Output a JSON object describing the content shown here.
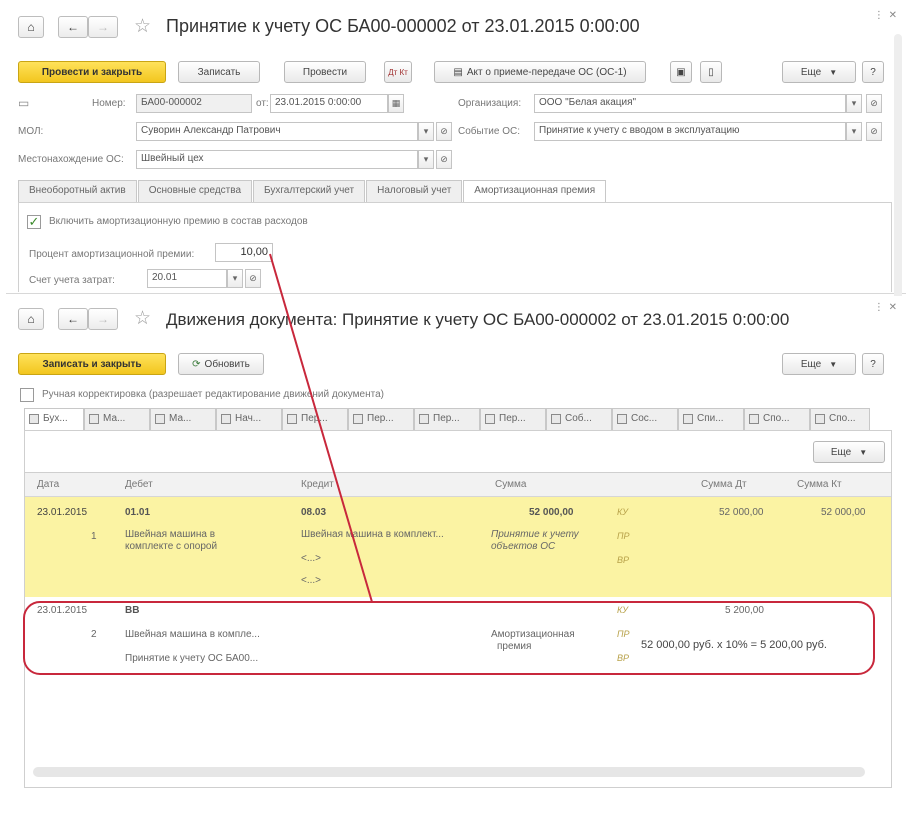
{
  "win1": {
    "title": "Принятие к учету ОС БА00-000002 от 23.01.2015 0:00:00",
    "corner": "⋮ ✕",
    "toolbar": {
      "post_close": "Провести и закрыть",
      "save": "Записать",
      "post": "Провести",
      "dt_kt": "Дт Кт",
      "act": "Акт о приеме-передаче ОС (ОС-1)",
      "more": "Еще"
    },
    "form": {
      "number_label": "Номер:",
      "number_value": "БА00-000002",
      "date_label": "от:",
      "date_value": "23.01.2015  0:00:00",
      "org_label": "Организация:",
      "org_value": "ООО \"Белая акация\"",
      "mol_label": "МОЛ:",
      "mol_value": "Суворин Александр Патрович",
      "event_label": "Событие ОС:",
      "event_value": "Принятие к учету с вводом в эксплуатацию",
      "location_label": "Местонахождение ОС:",
      "location_value": "Швейный цех"
    },
    "tabs": [
      "Внеоборотный актив",
      "Основные средства",
      "Бухгалтерский учет",
      "Налоговый учет",
      "Амортизационная премия"
    ],
    "premium": {
      "include_label": "Включить амортизационную премию в состав расходов",
      "percent_label": "Процент амортизационной премии:",
      "percent_value": "10,00",
      "account_label": "Счет учета затрат:",
      "account_value": "20.01"
    }
  },
  "win2": {
    "title": "Движения документа: Принятие к учету ОС БА00-000002 от 23.01.2015 0:00:00",
    "corner": "⋮ ✕",
    "toolbar": {
      "save_close": "Записать и закрыть",
      "refresh": "Обновить",
      "more": "Еще"
    },
    "manual_label": "Ручная корректировка (разрешает редактирование движений документа)",
    "tabs": [
      "Бух...",
      "Ма...",
      "Ма...",
      "Нач...",
      "Пер...",
      "Пер...",
      "Пер...",
      "Пер...",
      "Соб...",
      "Сос...",
      "Спи...",
      "Спо...",
      "Спо..."
    ],
    "grid_more": "Еще",
    "columns": [
      "Дата",
      "Дебет",
      "Кредит",
      "Сумма",
      "Сумма Дт",
      "Сумма Кт"
    ],
    "rows": [
      {
        "date": "23.01.2015",
        "num": "1",
        "debit": "01.01",
        "debit_sub1": "Швейная машина в",
        "debit_sub2": "комплекте с опорой",
        "credit": "08.03",
        "credit_sub1": "Швейная машина в комплект...",
        "credit_sub3": "<...>",
        "credit_sub4": "<...>",
        "amount": "52 000,00",
        "amount_sub1": "Принятие к учету",
        "amount_sub2": "объектов ОС",
        "k1": "КУ",
        "k2": "ПР",
        "k3": "ВР",
        "sum_dt": "52 000,00",
        "sum_kt": "52 000,00"
      },
      {
        "date": "23.01.2015",
        "num": "2",
        "debit": "ВВ",
        "debit_sub1": "Швейная машина в компле...",
        "debit_sub2": "Принятие к учету ОС БА00...",
        "amount_sub1": "Амортизационная",
        "amount_sub2": "премия",
        "k1": "КУ",
        "k2": "ПР",
        "k3": "ВР",
        "sum_dt": "5 200,00",
        "calc": "52 000,00 руб.   х 10% = 5 200,00 руб."
      }
    ]
  },
  "colors": {
    "primary_button": "#f5cb22",
    "selected_row": "#fbf3a3",
    "annotation": "#c8283c"
  }
}
